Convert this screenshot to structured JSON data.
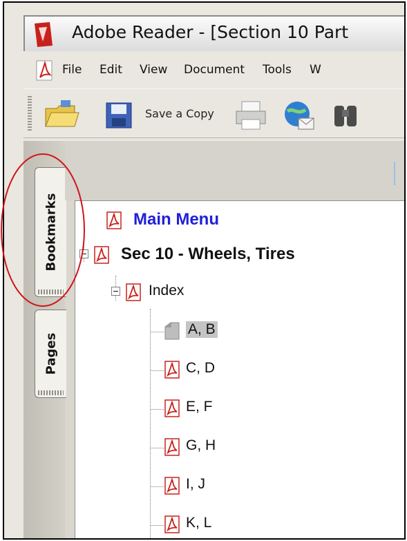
{
  "window": {
    "title": "Adobe Reader - [Section 10 Part"
  },
  "menu": {
    "items": [
      "File",
      "Edit",
      "View",
      "Document",
      "Tools",
      "W"
    ]
  },
  "toolbar": {
    "save_copy_label": "Save a Copy"
  },
  "nav_tabs": {
    "bookmarks": "Bookmarks",
    "pages": "Pages"
  },
  "bookmarks": {
    "main_menu": "Main Menu",
    "section": "Sec 10 - Wheels, Tires",
    "index": "Index",
    "entries": [
      "A, B",
      "C, D",
      "E, F",
      "G, H",
      "I, J",
      "K, L"
    ],
    "selected_entry": "A, B"
  },
  "colors": {
    "link_blue": "#1f20d8",
    "annotation_red": "#d0141a",
    "selection_gray": "#c4c4c4"
  }
}
